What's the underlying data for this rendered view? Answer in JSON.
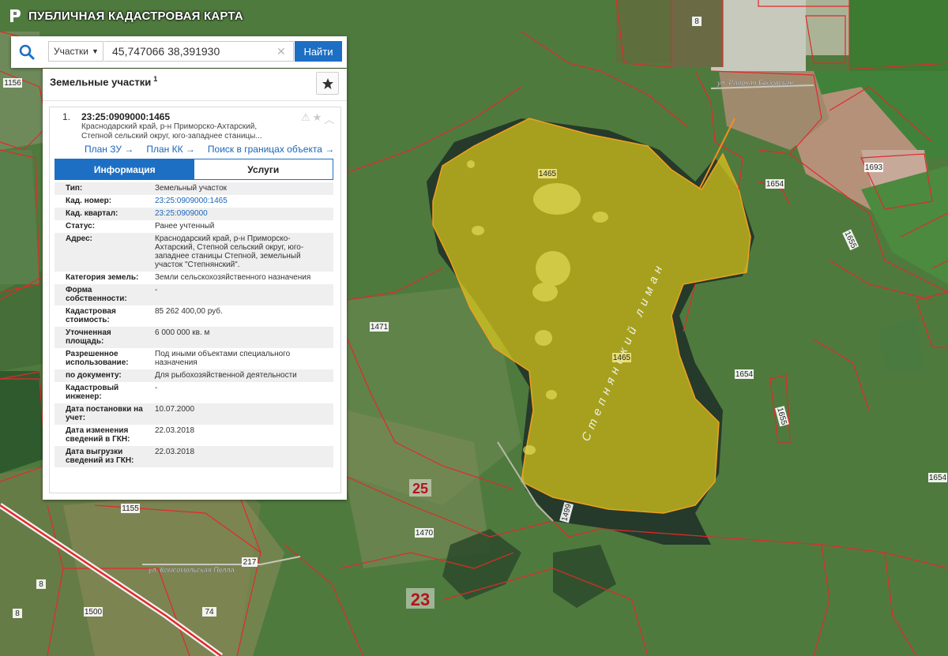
{
  "app": {
    "title": "ПУБЛИЧНАЯ КАДАСТРОВАЯ КАРТА"
  },
  "search": {
    "type_label": "Участки",
    "query": "45,747066 38,391930",
    "button_label": "Найти"
  },
  "panel": {
    "title": "Земельные участки",
    "count": "1",
    "result": {
      "index": "1.",
      "cad_number": "23:25:0909000:1465",
      "address_short": "Краснодарский край, р-н Приморско-Ахтарский, Степной сельский округ, юго-западнее станицы...",
      "links": [
        "План ЗУ →",
        "План КК →",
        "Поиск в границах объекта →"
      ],
      "tabs": [
        "Информация",
        "Услуги"
      ],
      "properties": [
        {
          "key": "Тип:",
          "value": "Земельный участок",
          "link": false
        },
        {
          "key": "Кад. номер:",
          "value": "23:25:0909000:1465",
          "link": true
        },
        {
          "key": "Кад. квартал:",
          "value": "23:25:0909000",
          "link": true
        },
        {
          "key": "Статус:",
          "value": "Ранее учтенный",
          "link": false
        },
        {
          "key": "Адрес:",
          "value": "Краснодарский край, р-н Приморско-Ахтарский, Степной сельский округ, юго-западнее станицы Степной, земельный участок \"Степнянский\".",
          "link": false
        },
        {
          "key": "Категория земель:",
          "value": "Земли сельскохозяйственного назначения",
          "link": false
        },
        {
          "key": "Форма собственности:",
          "value": "-",
          "link": false
        },
        {
          "key": "Кадастровая стоимость:",
          "value": "85 262 400,00 руб.",
          "link": false
        },
        {
          "key": "Уточненная площадь:",
          "value": "6 000 000 кв. м",
          "link": false
        },
        {
          "key": "Разрешенное использование:",
          "value": "Под иными объектами специального назначения",
          "link": false
        },
        {
          "key": "по документу:",
          "value": "Для рыбохозяйственной деятельности",
          "link": false
        },
        {
          "key": "Кадастровый инженер:",
          "value": "-",
          "link": false
        },
        {
          "key": "Дата постановки на учет:",
          "value": "10.07.2000",
          "link": false
        },
        {
          "key": "Дата изменения сведений в ГКН:",
          "value": "22.03.2018",
          "link": false
        },
        {
          "key": "Дата выгрузки сведений из ГКН:",
          "value": "22.03.2018",
          "link": false
        }
      ]
    }
  },
  "map": {
    "lake_name": "Степнянский лиман",
    "parcel_labels": [
      "1465",
      "1465",
      "1471",
      "1654",
      "1654",
      "1654",
      "1655",
      "1655",
      "1693",
      "1156",
      "1155",
      "1470",
      "1500",
      "1499",
      "8",
      "8",
      "8",
      "74",
      "217"
    ],
    "quarter_labels": [
      "25",
      "23"
    ],
    "road_labels": [
      "ул. Рабочая Бедовская",
      "ул. Комсомольская Пелла"
    ],
    "colors": {
      "parcel_fill": "#d8c81a",
      "boundary": "#e22a2a",
      "accent": "#1d6fc4"
    }
  }
}
